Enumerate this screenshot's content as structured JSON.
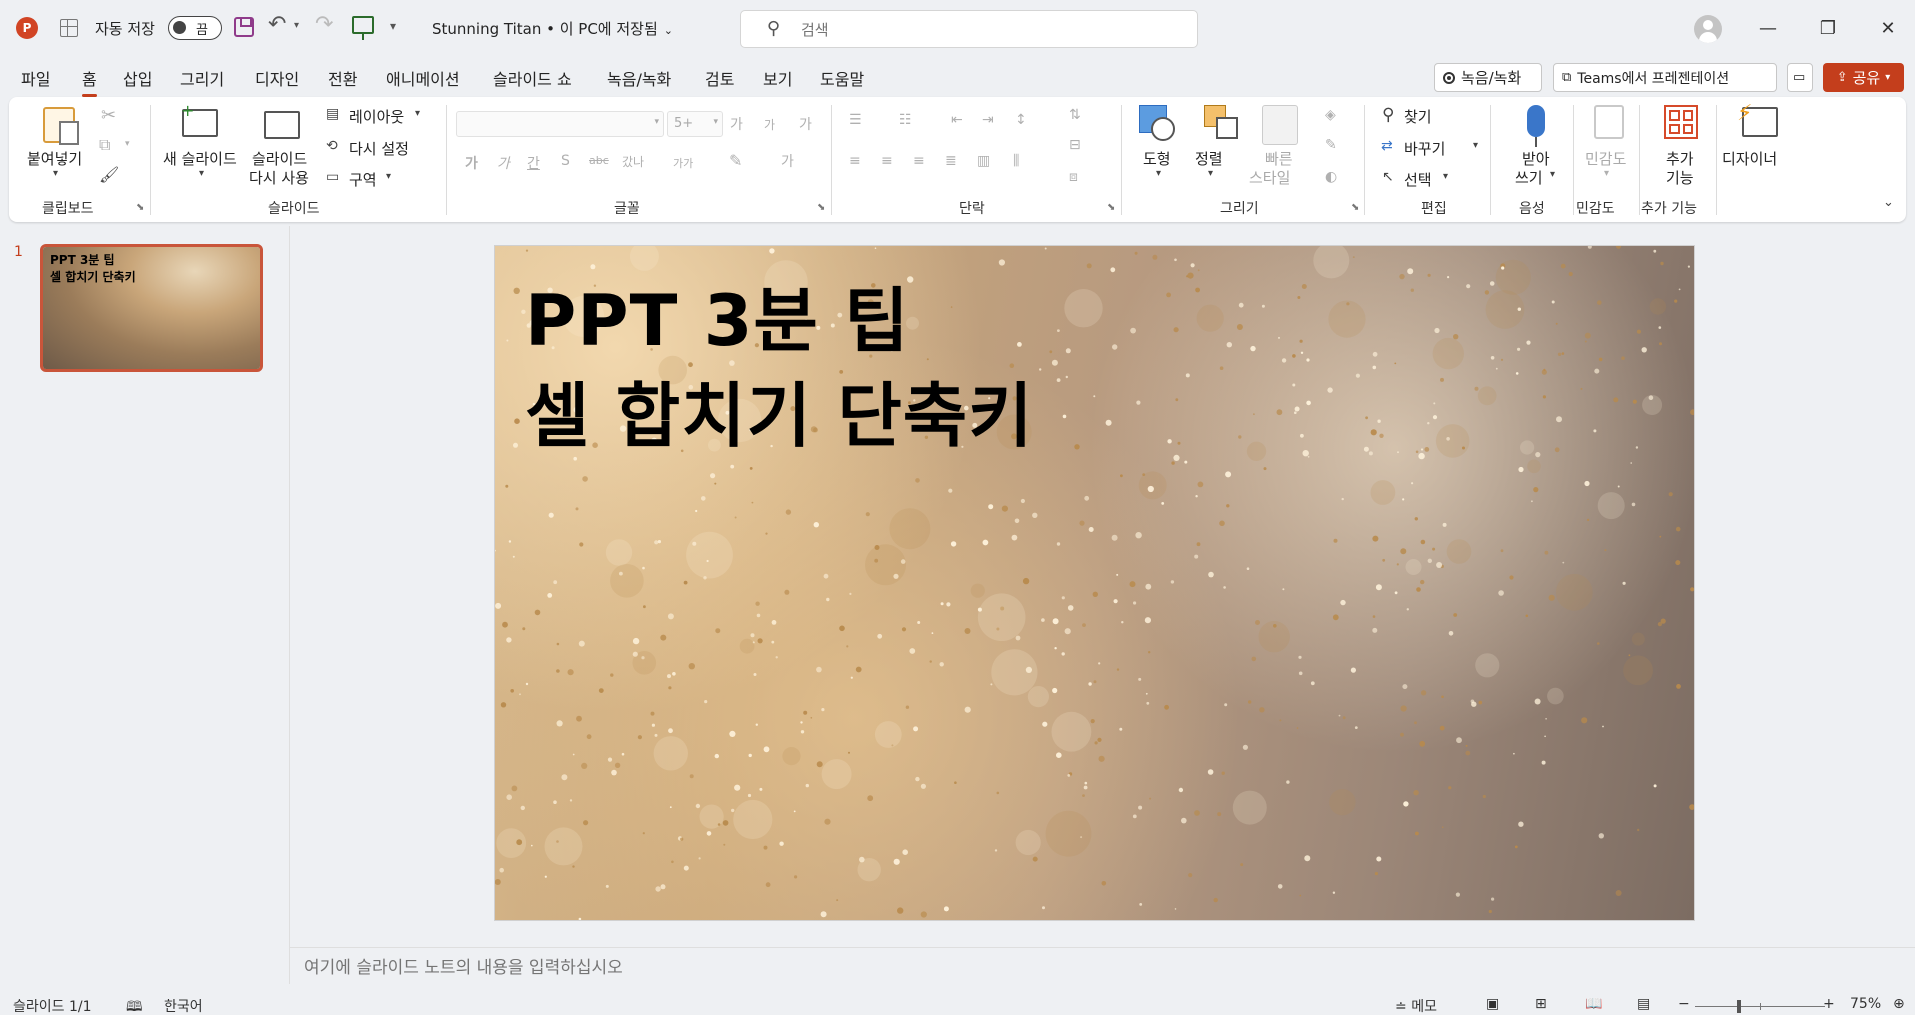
{
  "titlebar": {
    "autosave_label": "자동 저장",
    "autosave_state": "끔",
    "document_title": "Stunning Titan • 이 PC에 저장됨",
    "search_placeholder": "검색"
  },
  "menu": {
    "tabs": [
      "파일",
      "홈",
      "삽입",
      "그리기",
      "디자인",
      "전환",
      "애니메이션",
      "슬라이드 쇼",
      "녹음/녹화",
      "검토",
      "보기",
      "도움말"
    ],
    "active_tab": "홈",
    "record_label": "녹음/녹화",
    "teams_label": "Teams에서 프레젠테이션",
    "share_label": "공유"
  },
  "ribbon": {
    "clipboard": {
      "paste": "붙여넣기",
      "group": "클립보드"
    },
    "slides": {
      "new_slide": "새 슬라이드",
      "reuse_1": "슬라이드",
      "reuse_2": "다시 사용",
      "layout": "레이아웃",
      "reset": "다시 설정",
      "section": "구역",
      "group": "슬라이드"
    },
    "font": {
      "size_placeholder": "5+",
      "group": "글꼴",
      "bold": "가",
      "italic": "가",
      "underline": "간",
      "shadow": "S",
      "strike": "abc",
      "spacing": "갔나",
      "case": "가가",
      "grow": "가",
      "shrink": "가",
      "clear": "가"
    },
    "paragraph": {
      "group": "단락"
    },
    "drawing": {
      "shapes": "도형",
      "arrange": "정렬",
      "quick_styles_1": "빠른",
      "quick_styles_2": "스타일",
      "group": "그리기"
    },
    "editing": {
      "find": "찾기",
      "replace": "바꾸기",
      "select": "선택",
      "group": "편집"
    },
    "voice": {
      "dictate_1": "받아",
      "dictate_2": "쓰기",
      "group": "음성"
    },
    "sensitivity": {
      "label": "민감도",
      "group": "민감도"
    },
    "addins": {
      "label_1": "추가",
      "label_2": "기능",
      "group": "추가 기능"
    },
    "designer": {
      "label": "디자이너"
    }
  },
  "slides_panel": {
    "thumb_number": "1",
    "thumb_title_1": "PPT 3분 팁",
    "thumb_title_2": "셀 합치기 단축키"
  },
  "slide": {
    "title_line_1": "PPT 3분 팁",
    "title_line_2": "셀 합치기 단축키"
  },
  "notes": {
    "placeholder": "여기에 슬라이드 노트의 내용을 입력하십시오"
  },
  "status": {
    "slide_count": "슬라이드 1/1",
    "language": "한국어",
    "notes_label": "메모",
    "zoom": "75%",
    "zoom_minus": "−",
    "zoom_plus": "+"
  },
  "colors": {
    "accent": "#c43e1c",
    "ribbon_bg": "#ffffff",
    "app_bg": "#eef0f3"
  }
}
